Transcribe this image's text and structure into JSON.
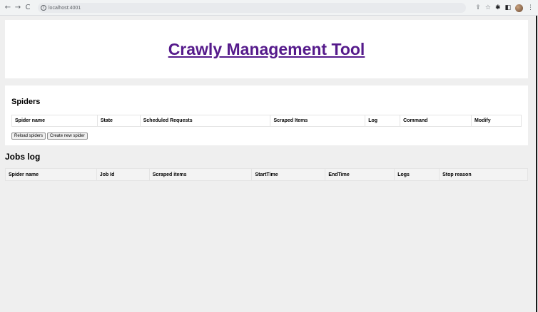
{
  "browser": {
    "url": "localhost:4001",
    "nav": {
      "back": "←",
      "forward": "→",
      "reload": "C"
    },
    "info": "i",
    "icons": [
      "share-icon",
      "star-icon",
      "extension-icon",
      "sidebar-icon",
      "profile-avatar",
      "menu-icon"
    ],
    "glyphs": {
      "share": "⇪",
      "star": "☆",
      "extension": "✱",
      "sidebar": "◧",
      "menu": "⋮"
    }
  },
  "header": {
    "title": "Crawly Management Tool"
  },
  "spiders": {
    "title": "Spiders",
    "columns": [
      "Spider name",
      "State",
      "Scheduled Requests",
      "Scraped Items",
      "Log",
      "Command",
      "Modify"
    ],
    "buttons": {
      "reload": "Reload spiders",
      "create": "Create new spider"
    }
  },
  "jobs": {
    "title": "Jobs log",
    "columns": [
      "Spider name",
      "Job Id",
      "Scraped items",
      "StartTime",
      "EndTime",
      "Logs",
      "Stop reason"
    ]
  },
  "colors": {
    "link_visited": "#551a8b",
    "page_bg": "#efefef",
    "card_bg": "#ffffff"
  }
}
